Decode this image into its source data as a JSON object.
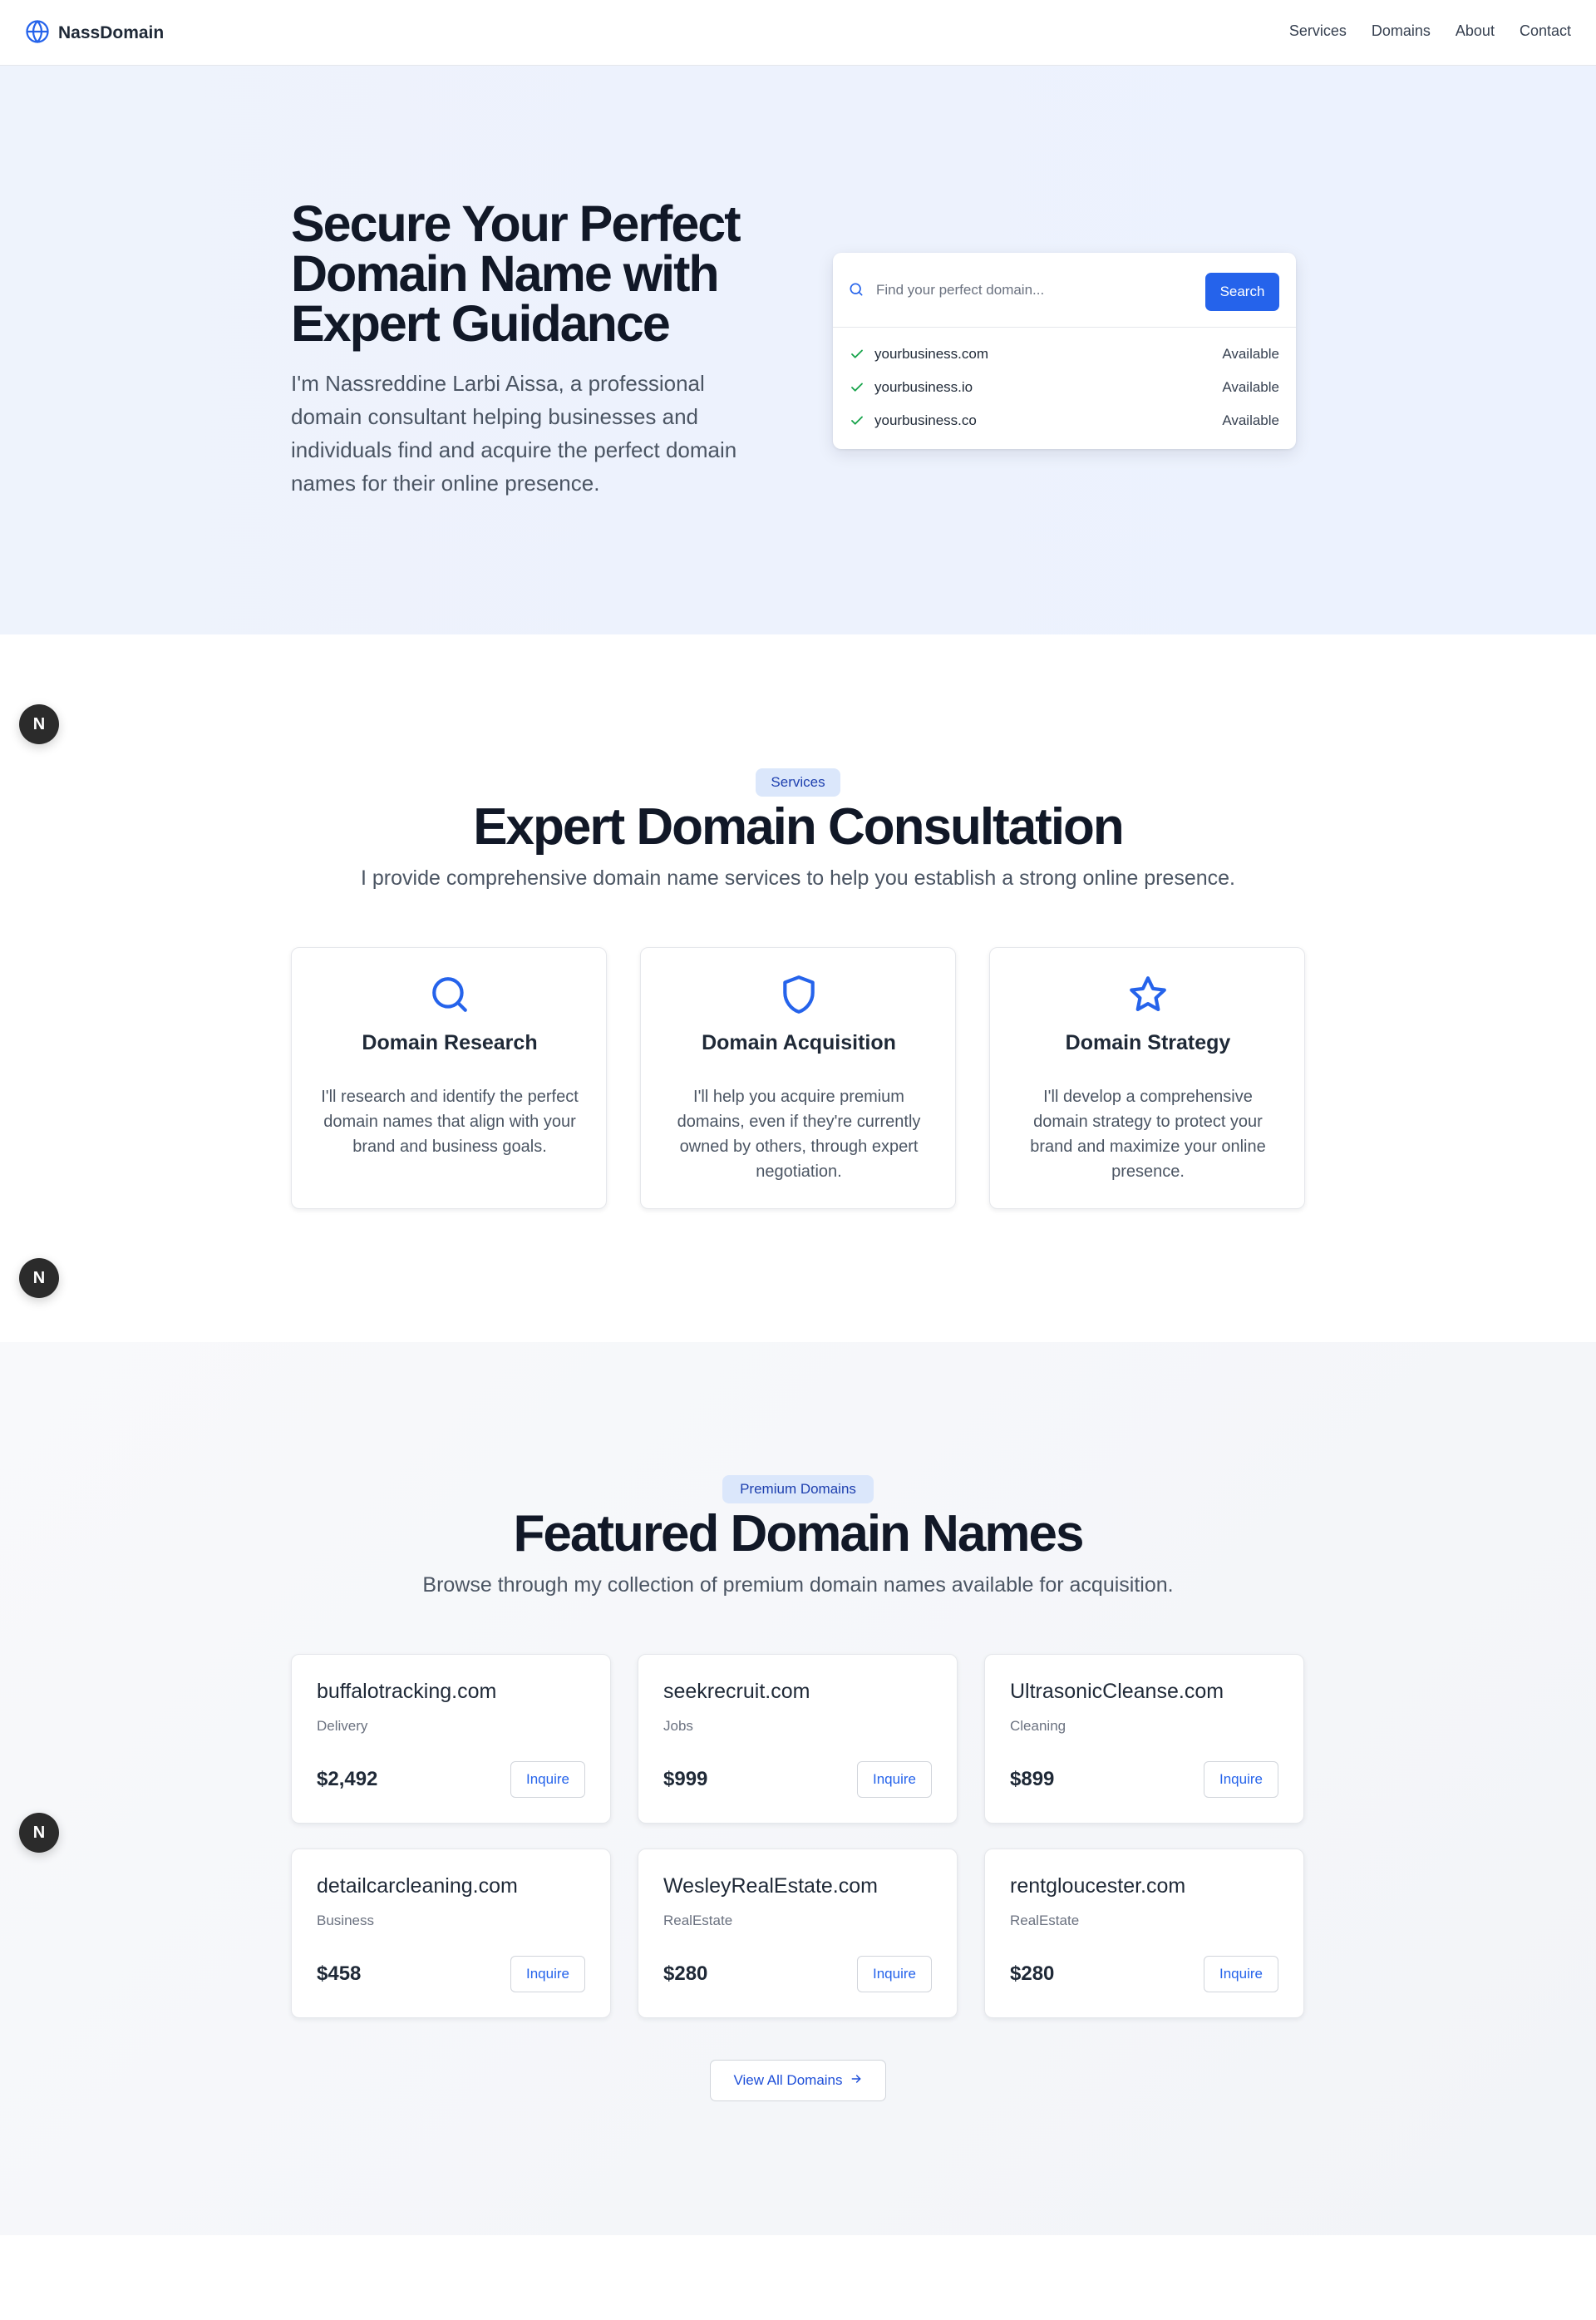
{
  "header": {
    "brand": "NassDomain",
    "nav": [
      "Services",
      "Domains",
      "About",
      "Contact"
    ]
  },
  "hero": {
    "title": "Secure Your Perfect Domain Name with Expert Guidance",
    "description": "I'm Nassreddine Larbi Aissa, a professional domain consultant helping businesses and individuals find and acquire the perfect domain names for their online presence.",
    "search": {
      "placeholder": "Find your perfect domain...",
      "button": "Search",
      "results": [
        {
          "name": "yourbusiness.com",
          "status": "Available"
        },
        {
          "name": "yourbusiness.io",
          "status": "Available"
        },
        {
          "name": "yourbusiness.co",
          "status": "Available"
        }
      ]
    }
  },
  "services": {
    "badge": "Services",
    "title": "Expert Domain Consultation",
    "subtitle": "I provide comprehensive domain name services to help you establish a strong online presence.",
    "items": [
      {
        "icon": "search-icon",
        "title": "Domain Research",
        "description": "I'll research and identify the perfect domain names that align with your brand and business goals."
      },
      {
        "icon": "shield-icon",
        "title": "Domain Acquisition",
        "description": "I'll help you acquire premium domains, even if they're currently owned by others, through expert negotiation."
      },
      {
        "icon": "star-icon",
        "title": "Domain Strategy",
        "description": "I'll develop a comprehensive domain strategy to protect your brand and maximize your online presence."
      }
    ]
  },
  "featured": {
    "badge": "Premium Domains",
    "title": "Featured Domain Names",
    "subtitle": "Browse through my collection of premium domain names available for acquisition.",
    "inquire_label": "Inquire",
    "domains": [
      {
        "name": "buffalotracking.com",
        "category": "Delivery",
        "price": "$2,492"
      },
      {
        "name": "seekrecruit.com",
        "category": "Jobs",
        "price": "$999"
      },
      {
        "name": "UltrasonicCleanse.com",
        "category": "Cleaning",
        "price": "$899"
      },
      {
        "name": "detailcarcleaning.com",
        "category": "Business",
        "price": "$458"
      },
      {
        "name": "WesleyRealEstate.com",
        "category": "RealEstate",
        "price": "$280"
      },
      {
        "name": "rentgloucester.com",
        "category": "RealEstate",
        "price": "$280"
      }
    ],
    "view_all": "View All Domains"
  },
  "floating_badge": "N",
  "colors": {
    "accent": "#2563eb",
    "check": "#16a34a",
    "text_dark": "#111827",
    "badge_bg": "#dbe7fb"
  }
}
